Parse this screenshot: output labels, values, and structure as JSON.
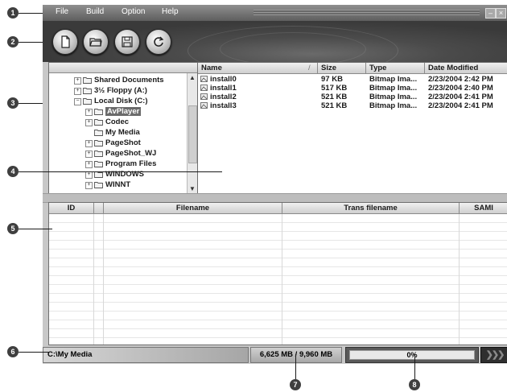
{
  "menu": {
    "items": [
      "File",
      "Build",
      "Option",
      "Help"
    ],
    "minimize_glyph": "–",
    "close_glyph": "×"
  },
  "toolbar": {
    "buttons": [
      "new-document-icon",
      "open-folder-icon",
      "save-disk-icon",
      "refresh-icon"
    ]
  },
  "tree": {
    "items": [
      {
        "label": "Shared Documents",
        "expander": "+",
        "icon": "folder-icon"
      },
      {
        "label": "3½ Floppy (A:)",
        "expander": "+",
        "icon": "floppy-drive-icon"
      },
      {
        "label": "Local Disk (C:)",
        "expander": "−",
        "icon": "hard-disk-icon"
      },
      {
        "label": "AvPlayer",
        "expander": "+",
        "icon": "folder-icon",
        "selected": true
      },
      {
        "label": "Codec",
        "expander": "+",
        "icon": "folder-icon"
      },
      {
        "label": "My Media",
        "expander": "",
        "icon": "folder-icon"
      },
      {
        "label": "PageShot",
        "expander": "+",
        "icon": "folder-icon"
      },
      {
        "label": "PageShot_WJ",
        "expander": "+",
        "icon": "folder-icon"
      },
      {
        "label": "Program Files",
        "expander": "+",
        "icon": "folder-icon"
      },
      {
        "label": "WINDOWS",
        "expander": "+",
        "icon": "folder-icon"
      },
      {
        "label": "WINNT",
        "expander": "+",
        "icon": "folder-icon"
      }
    ]
  },
  "files": {
    "columns": [
      "Name",
      "Size",
      "Type",
      "Date Modified"
    ],
    "rows": [
      {
        "name": "install0",
        "size": "97 KB",
        "type": "Bitmap Ima...",
        "date": "2/23/2004 2:42 PM"
      },
      {
        "name": "install1",
        "size": "517 KB",
        "type": "Bitmap Ima...",
        "date": "2/23/2004 2:40 PM"
      },
      {
        "name": "install2",
        "size": "521 KB",
        "type": "Bitmap Ima...",
        "date": "2/23/2004 2:41 PM"
      },
      {
        "name": "install3",
        "size": "521 KB",
        "type": "Bitmap Ima...",
        "date": "2/23/2004 2:41 PM"
      }
    ]
  },
  "grid": {
    "columns": [
      "ID",
      "",
      "Filename",
      "Trans filename",
      "SAMI"
    ]
  },
  "status": {
    "path": "C:\\My Media",
    "disk": "6,625 MB / 9,960 MB",
    "progress_text": "0%",
    "progress_value": 0,
    "go_glyph": "❯❯❯"
  },
  "callouts": [
    "1",
    "2",
    "3",
    "4",
    "5",
    "6",
    "7",
    "8"
  ]
}
